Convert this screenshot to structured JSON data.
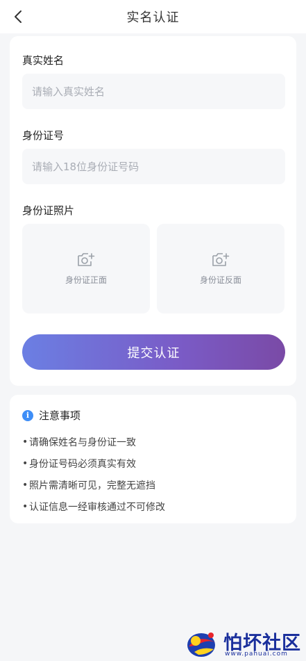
{
  "header": {
    "title": "实名认证"
  },
  "form": {
    "name_label": "真实姓名",
    "name_placeholder": "请输入真实姓名",
    "id_label": "身份证号",
    "id_placeholder": "请输入18位身份证号码",
    "photo_label": "身份证照片",
    "front_label": "身份证正面",
    "back_label": "身份证反面",
    "submit_label": "提交认证"
  },
  "notice": {
    "title": "注意事项",
    "items": [
      "请确保姓名与身份证一致",
      "身份证号码必须真实有效",
      "照片需清晰可见，完整无遮挡",
      "认证信息一经审核通过不可修改"
    ]
  },
  "watermark": {
    "text": "怕坏社区",
    "url": "www.pahuai.com"
  },
  "colors": {
    "accent_start": "#6b7fe3",
    "accent_end": "#7a4aa6",
    "info": "#3e8ef7"
  }
}
